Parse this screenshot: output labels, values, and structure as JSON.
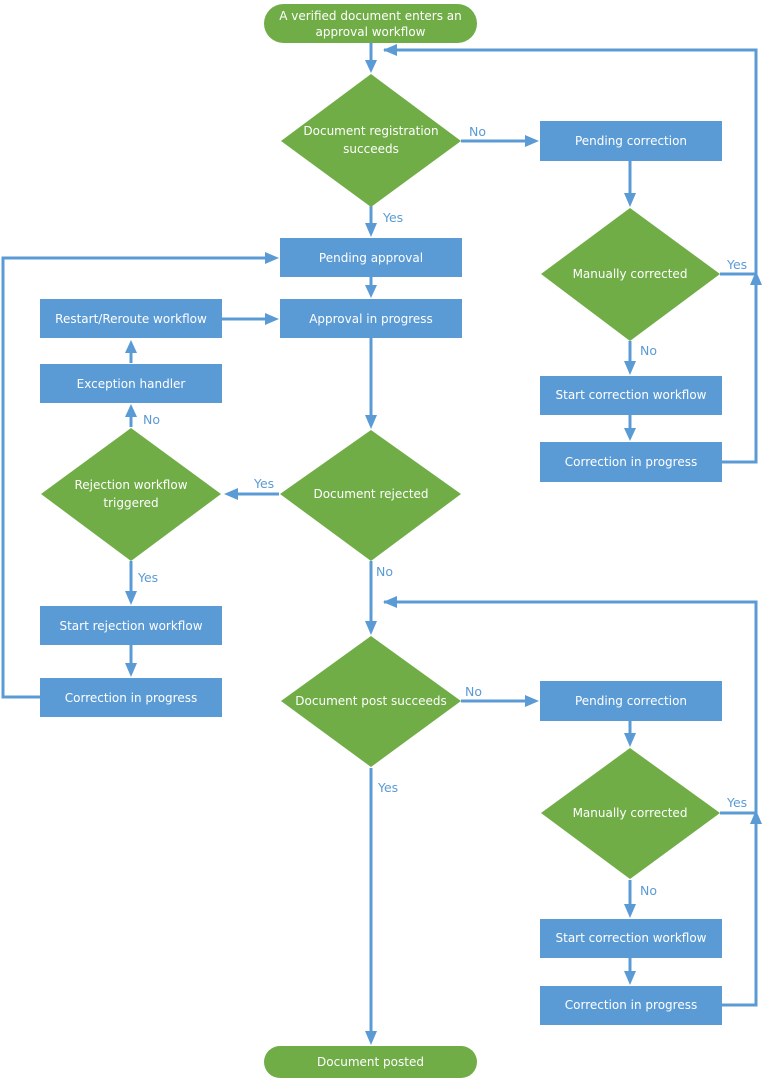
{
  "colors": {
    "process": "#5b9bd5",
    "decision": "#70ad47",
    "connector": "#5b9bd5",
    "text": "#ffffff"
  },
  "nodes": {
    "start": {
      "lines": [
        "A verified document enters an",
        "approval workflow"
      ],
      "type": "terminal"
    },
    "registration_decision": {
      "lines": [
        "Document registration",
        "succeeds"
      ],
      "type": "decision"
    },
    "pending_correction_1": {
      "lines": [
        "Pending correction"
      ],
      "type": "process"
    },
    "manually_corrected_1": {
      "lines": [
        "Manually corrected"
      ],
      "type": "decision"
    },
    "start_correction_workflow_1": {
      "lines": [
        "Start correction workflow"
      ],
      "type": "process"
    },
    "correction_in_progress_1": {
      "lines": [
        "Correction in progress"
      ],
      "type": "process"
    },
    "pending_approval": {
      "lines": [
        "Pending approval"
      ],
      "type": "process"
    },
    "approval_in_progress": {
      "lines": [
        "Approval in progress"
      ],
      "type": "process"
    },
    "restart_reroute": {
      "lines": [
        "Restart/Reroute workflow"
      ],
      "type": "process"
    },
    "exception_handler": {
      "lines": [
        "Exception handler"
      ],
      "type": "process"
    },
    "rejection_triggered": {
      "lines": [
        "Rejection workflow",
        "triggered"
      ],
      "type": "decision"
    },
    "document_rejected": {
      "lines": [
        "Document rejected"
      ],
      "type": "decision"
    },
    "start_rejection_workflow": {
      "lines": [
        "Start rejection workflow"
      ],
      "type": "process"
    },
    "correction_in_progress_left": {
      "lines": [
        "Correction in progress"
      ],
      "type": "process"
    },
    "post_decision": {
      "lines": [
        "Document post succeeds"
      ],
      "type": "decision"
    },
    "pending_correction_2": {
      "lines": [
        "Pending correction"
      ],
      "type": "process"
    },
    "manually_corrected_2": {
      "lines": [
        "Manually corrected"
      ],
      "type": "decision"
    },
    "start_correction_workflow_2": {
      "lines": [
        "Start correction workflow"
      ],
      "type": "process"
    },
    "correction_in_progress_2": {
      "lines": [
        "Correction in progress"
      ],
      "type": "process"
    },
    "end": {
      "lines": [
        "Document posted"
      ],
      "type": "terminal"
    }
  },
  "edge_labels": {
    "registration_no": "No",
    "registration_yes": "Yes",
    "manual1_yes": "Yes",
    "manual1_no": "No",
    "rejected_yes": "Yes",
    "rejected_no": "No",
    "triggered_no": "No",
    "triggered_yes": "Yes",
    "post_no": "No",
    "post_yes": "Yes",
    "manual2_yes": "Yes",
    "manual2_no": "No"
  },
  "edges": [
    {
      "from": "start",
      "to": "registration_decision"
    },
    {
      "from": "registration_decision",
      "to": "pending_correction_1",
      "label": "No"
    },
    {
      "from": "registration_decision",
      "to": "pending_approval",
      "label": "Yes"
    },
    {
      "from": "pending_correction_1",
      "to": "manually_corrected_1"
    },
    {
      "from": "manually_corrected_1",
      "to": "registration_decision",
      "label": "Yes"
    },
    {
      "from": "manually_corrected_1",
      "to": "start_correction_workflow_1",
      "label": "No"
    },
    {
      "from": "start_correction_workflow_1",
      "to": "correction_in_progress_1"
    },
    {
      "from": "correction_in_progress_1",
      "to": "registration_decision"
    },
    {
      "from": "pending_approval",
      "to": "approval_in_progress"
    },
    {
      "from": "approval_in_progress",
      "to": "document_rejected"
    },
    {
      "from": "document_rejected",
      "to": "rejection_triggered",
      "label": "Yes"
    },
    {
      "from": "document_rejected",
      "to": "post_decision",
      "label": "No"
    },
    {
      "from": "rejection_triggered",
      "to": "exception_handler",
      "label": "No"
    },
    {
      "from": "exception_handler",
      "to": "restart_reroute"
    },
    {
      "from": "restart_reroute",
      "to": "approval_in_progress"
    },
    {
      "from": "rejection_triggered",
      "to": "start_rejection_workflow",
      "label": "Yes"
    },
    {
      "from": "start_rejection_workflow",
      "to": "correction_in_progress_left"
    },
    {
      "from": "correction_in_progress_left",
      "to": "pending_approval"
    },
    {
      "from": "post_decision",
      "to": "pending_correction_2",
      "label": "No"
    },
    {
      "from": "post_decision",
      "to": "end",
      "label": "Yes"
    },
    {
      "from": "pending_correction_2",
      "to": "manually_corrected_2"
    },
    {
      "from": "manually_corrected_2",
      "to": "post_decision",
      "label": "Yes"
    },
    {
      "from": "manually_corrected_2",
      "to": "start_correction_workflow_2",
      "label": "No"
    },
    {
      "from": "start_correction_workflow_2",
      "to": "correction_in_progress_2"
    },
    {
      "from": "correction_in_progress_2",
      "to": "post_decision"
    }
  ]
}
